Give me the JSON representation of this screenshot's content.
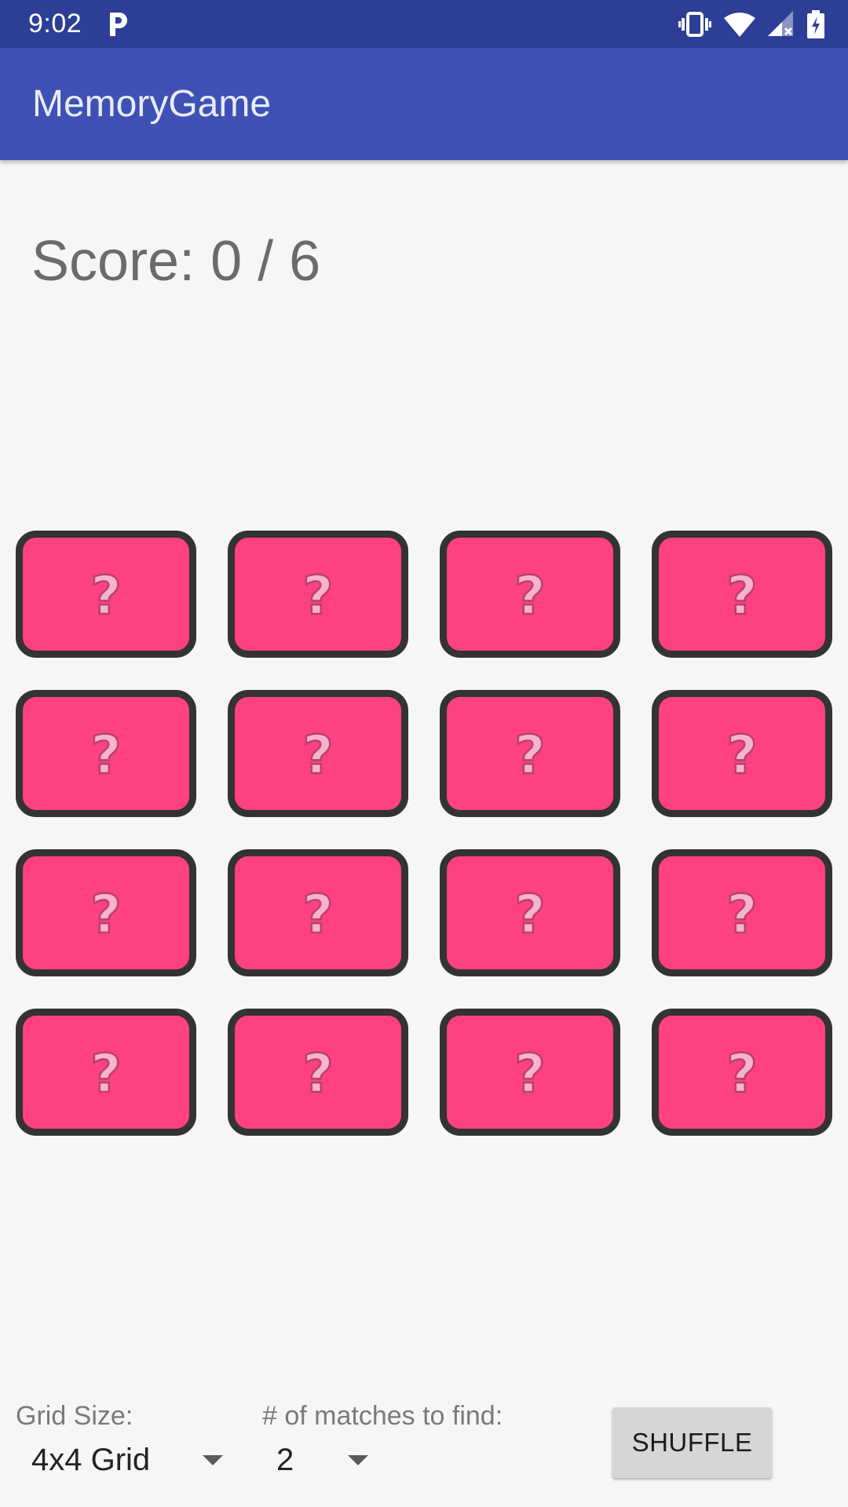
{
  "status_bar": {
    "time": "9:02",
    "icons": [
      "parking-icon",
      "vibrate-icon",
      "wifi-icon",
      "cell-signal-icon",
      "battery-charging-icon"
    ]
  },
  "app_bar": {
    "title": "MemoryGame"
  },
  "score": {
    "text": "Score: 0 / 6"
  },
  "board": {
    "rows": 4,
    "columns": 4,
    "card_face": "?",
    "card_color": "#ff4081",
    "card_border_color": "#333333"
  },
  "controls": {
    "grid_size_label": "Grid Size:",
    "grid_size_value": "4x4 Grid",
    "matches_label": "# of matches to find:",
    "matches_value": "2",
    "shuffle_label": "SHUFFLE"
  },
  "colors": {
    "status_bar": "#2c3e96",
    "app_bar": "#3f51b5",
    "background": "#f6f7f5"
  }
}
